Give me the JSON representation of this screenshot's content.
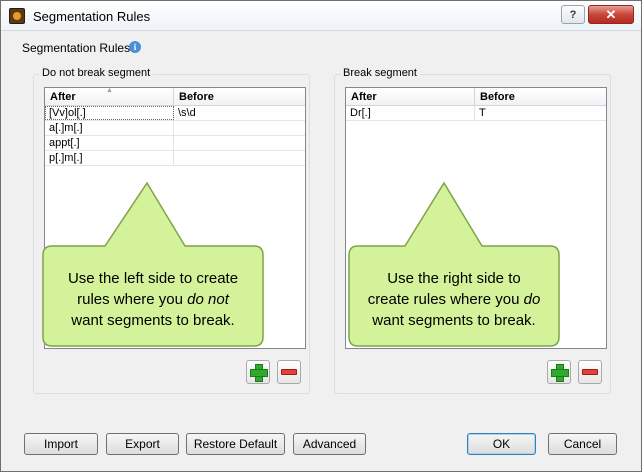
{
  "window": {
    "title": "Segmentation Rules",
    "help_label": "?",
    "close_label": "✕"
  },
  "header": {
    "label": "Segmentation Rules",
    "info_glyph": "i"
  },
  "left_group": {
    "label": "Do not break segment",
    "columns": [
      "After",
      "Before"
    ],
    "rows": [
      [
        "[Vv]ol[.]",
        "\\s\\d"
      ],
      [
        "a[.]m[.]",
        ""
      ],
      [
        "appt[.]",
        ""
      ],
      [
        "p[.]m[.]",
        ""
      ]
    ]
  },
  "right_group": {
    "label": "Break segment",
    "columns": [
      "After",
      "Before"
    ],
    "rows": [
      [
        "Dr[.]",
        "T"
      ]
    ]
  },
  "callouts": {
    "left_line1": "Use the left side to create",
    "left_line2a": "rules where you ",
    "left_line2b": "do not",
    "left_line3": "want segments to break.",
    "right_line1": "Use the right side to",
    "right_line2a": "create rules where you ",
    "right_line2b": "do",
    "right_line3": "want segments to break."
  },
  "buttons": {
    "import": "Import",
    "export": "Export",
    "restore_default": "Restore Default",
    "advanced": "Advanced",
    "ok": "OK",
    "cancel": "Cancel"
  },
  "colors": {
    "callout_fill": "#d4f29a",
    "callout_stroke": "#7fa34a"
  }
}
